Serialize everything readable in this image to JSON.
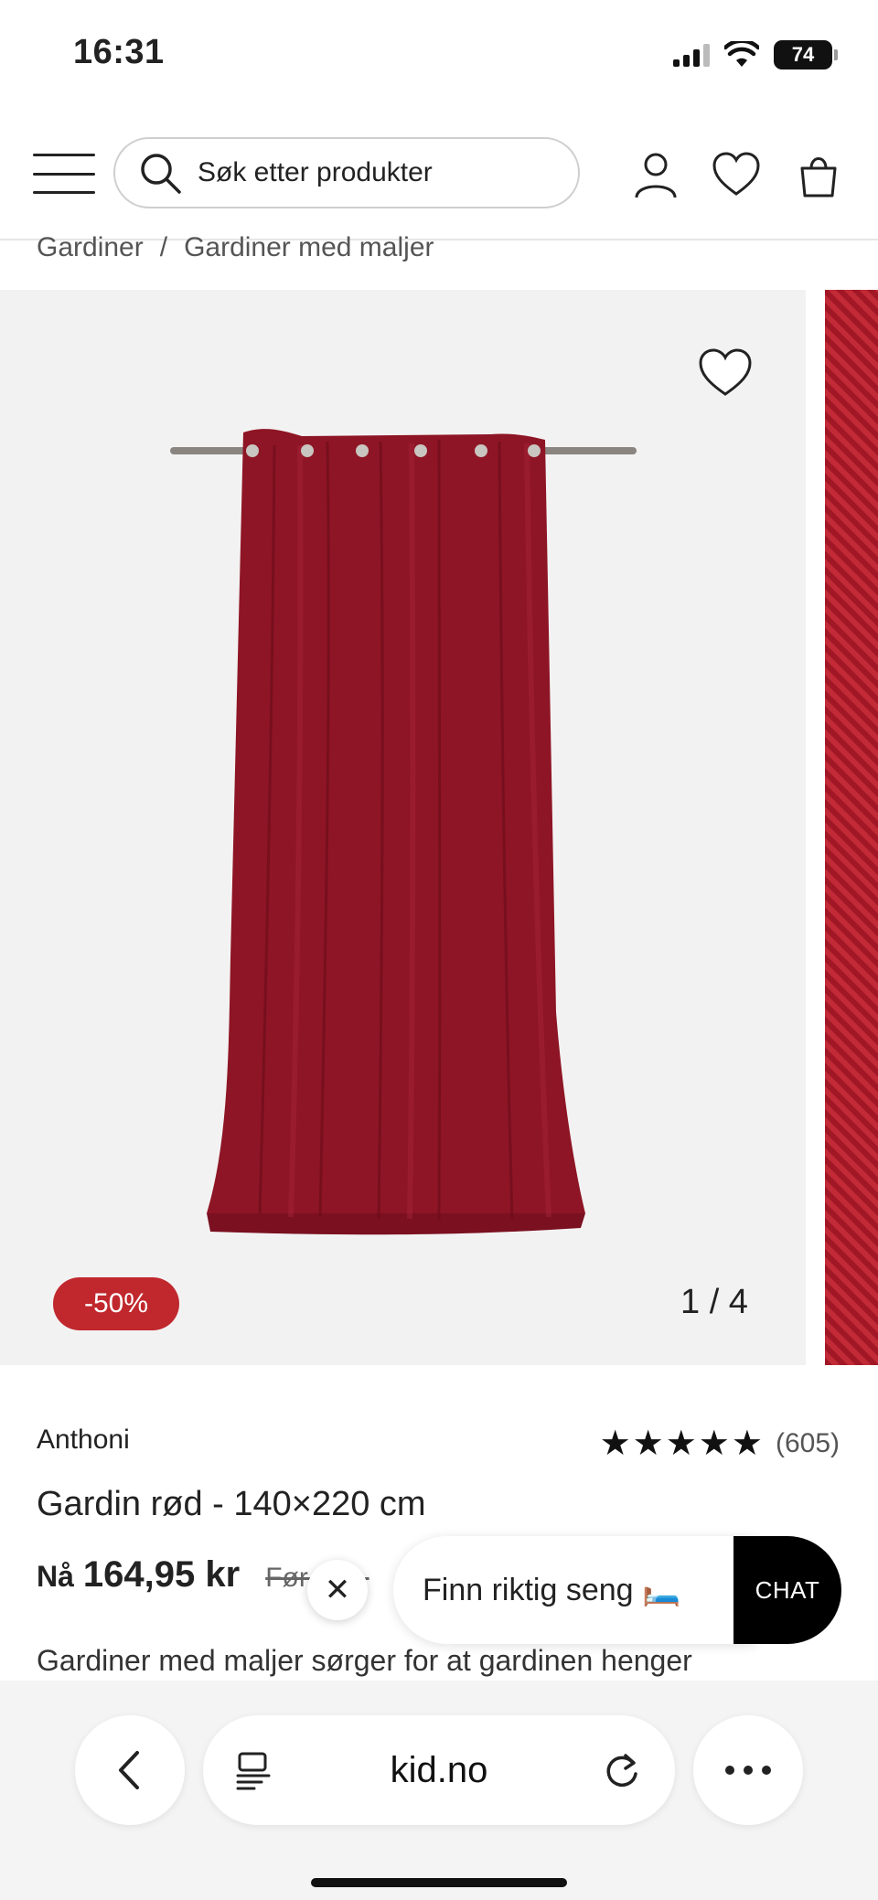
{
  "status_bar": {
    "time": "16:31",
    "battery": "74"
  },
  "header": {
    "search_placeholder": "Søk etter produkter"
  },
  "breadcrumb": {
    "items": [
      "Gardiner",
      "Gardiner med maljer"
    ],
    "separator": "/"
  },
  "gallery": {
    "discount_badge": "-50%",
    "counter": "1 / 4"
  },
  "product": {
    "brand": "Anthoni",
    "rating_stars": "★★★★★",
    "review_count": "(605)",
    "title": "Gardin rød - 140×220 cm",
    "price_prefix": "Nå",
    "price_now": "164,95 kr",
    "price_before": "Før 329,",
    "description": "Gardiner med maljer sørger for at gardinen henger"
  },
  "chat_widget": {
    "promo_text": "Finn riktig seng 🛏️",
    "chat_label": "CHAT"
  },
  "browser": {
    "url": "kid.no"
  },
  "colors": {
    "accent": "#c0282d",
    "curtain": "#8e1525"
  }
}
